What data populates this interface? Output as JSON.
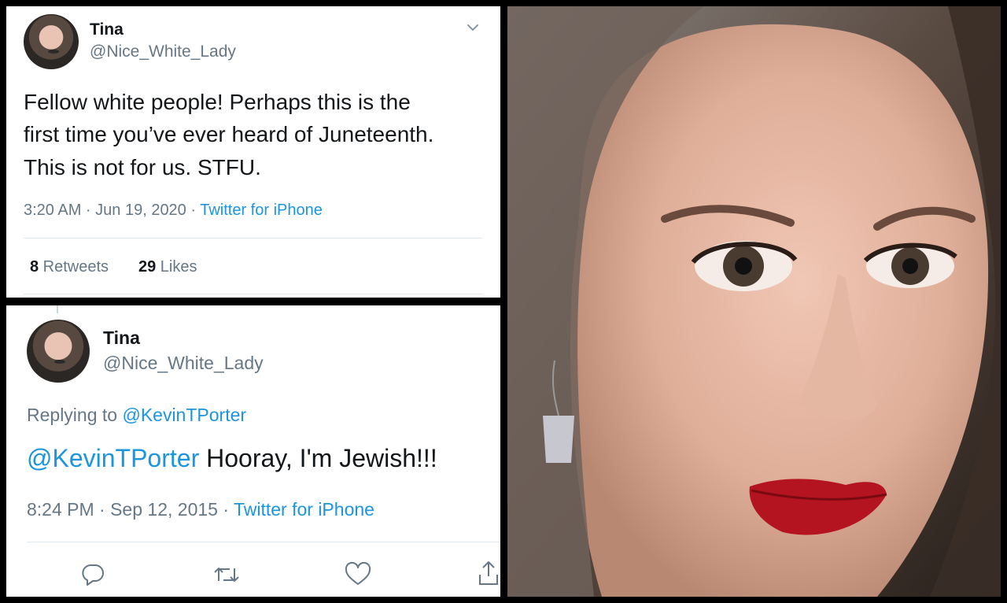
{
  "tweet_top": {
    "name": "Tina",
    "handle": "@Nice_White_Lady",
    "text_line1": "Fellow white people! Perhaps this is the",
    "text_line2": "first time you’ve ever heard of Juneteenth.",
    "text_line3": "This is not for us. STFU.",
    "time": "3:20 AM · Jun 19, 2020 · ",
    "source": "Twitter for iPhone",
    "retweets_count": "8",
    "retweets_label": " Retweets",
    "likes_count": "29",
    "likes_label": " Likes",
    "menu_icon": "chevron-down-icon"
  },
  "tweet_bottom": {
    "name": "Tina",
    "handle": "@Nice_White_Lady",
    "replying_prefix": "Replying to ",
    "replying_to": "@KevinTPorter",
    "mention": "@KevinTPorter",
    "text": " Hooray, I'm Jewish!!!",
    "time": "8:24 PM · Sep 12, 2015 · ",
    "source": "Twitter for iPhone",
    "actions": [
      "reply-icon",
      "retweet-icon",
      "like-icon",
      "share-icon"
    ]
  },
  "colors": {
    "link": "#1b95e0",
    "secondary": "#657786",
    "primary": "#14171a",
    "divider": "#e1e8ed"
  }
}
